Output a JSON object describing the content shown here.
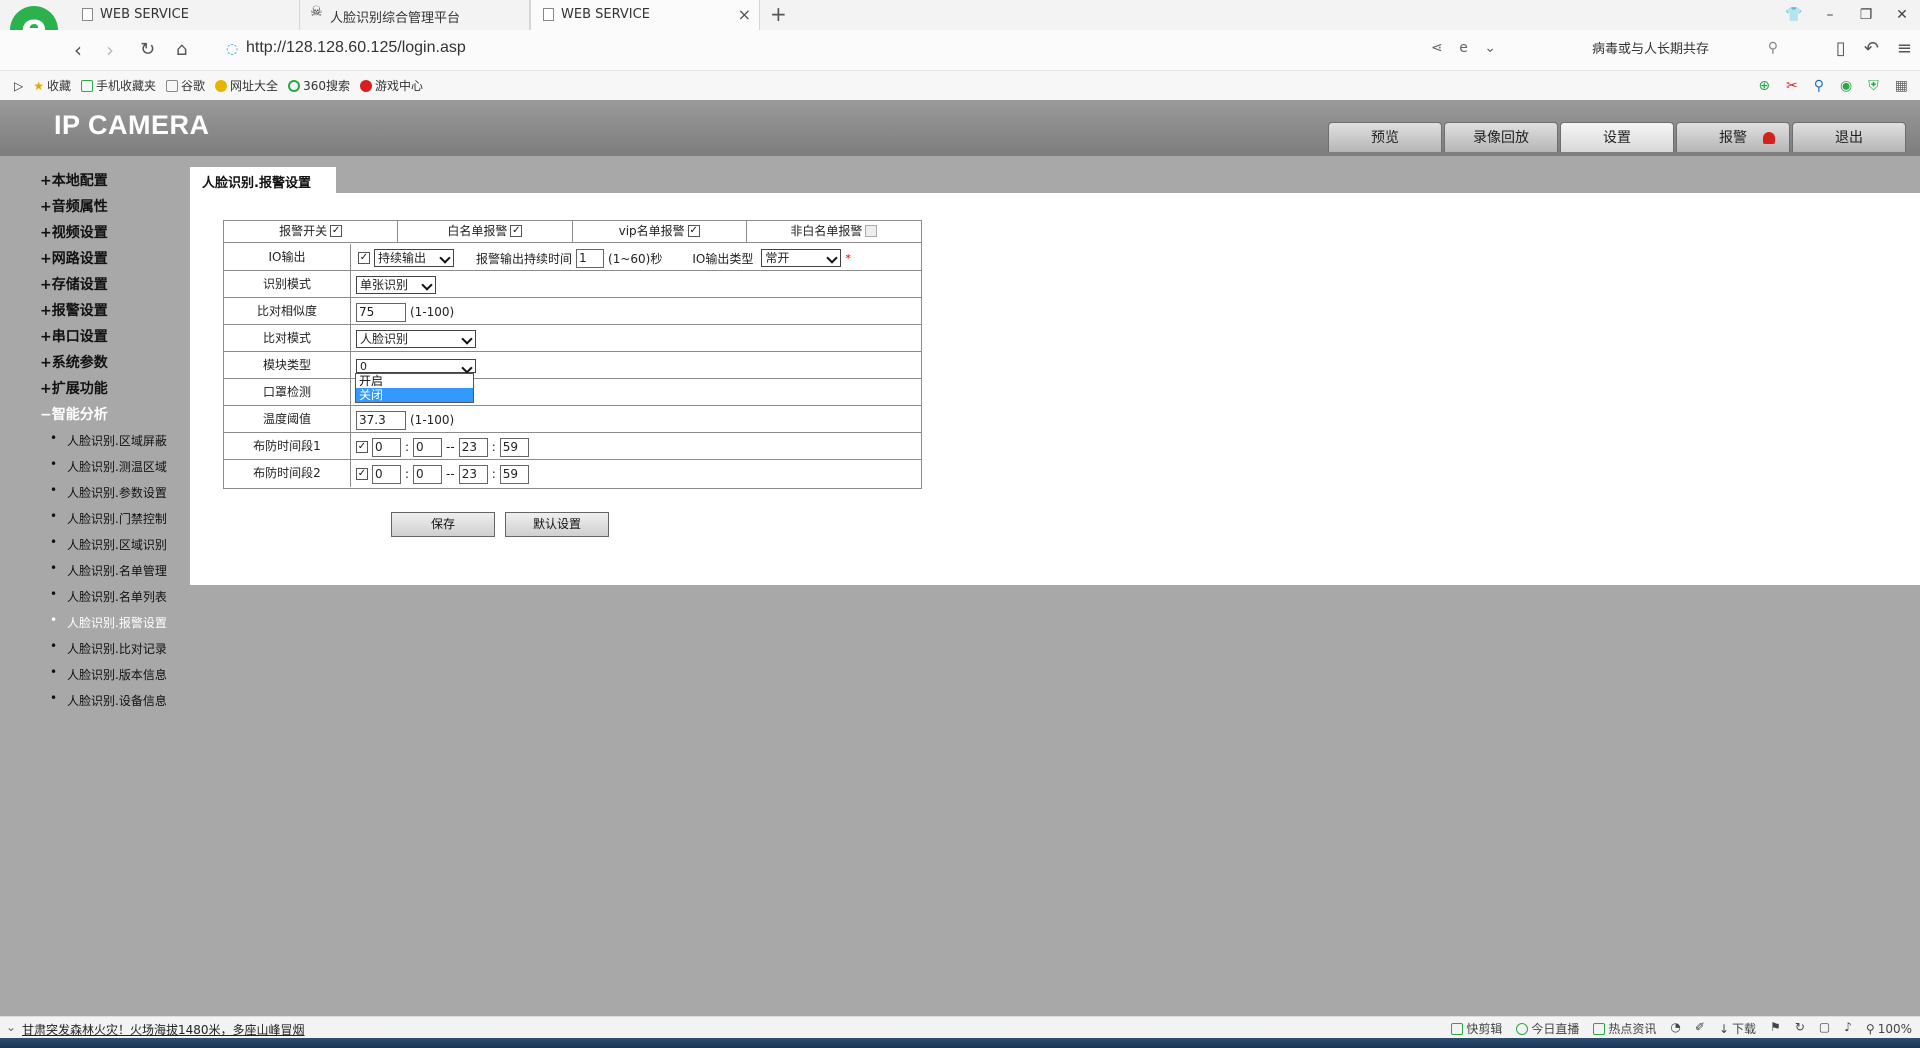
{
  "browser": {
    "tabs": [
      {
        "title": "WEB SERVICE",
        "icon": "page-icon"
      },
      {
        "title": "人脸识别综合管理平台",
        "icon": "skull-icon"
      },
      {
        "title": "WEB SERVICE",
        "icon": "page-icon",
        "active": true
      }
    ],
    "close_glyph": "×",
    "new_tab_glyph": "+",
    "url": "http://128.128.60.125/login.asp",
    "search_text": "病毒或与人长期共存",
    "bookmarks": [
      "收藏",
      "手机收藏夹",
      "谷歌",
      "网址大全",
      "360搜索",
      "游戏中心"
    ]
  },
  "camera": {
    "brand": "IP CAMERA",
    "nav": [
      "预览",
      "录像回放",
      "设置",
      "报警",
      "退出"
    ],
    "active_nav": "设置",
    "sidebar_menu": [
      "+本地配置",
      "+音频属性",
      "+视频设置",
      "+网路设置",
      "+存储设置",
      "+报警设置",
      "+串口设置",
      "+系统参数",
      "+扩展功能",
      "−智能分析"
    ],
    "sidebar_sub": [
      "人脸识别.区域屏蔽",
      "人脸识别.测温区域",
      "人脸识别.参数设置",
      "人脸识别.门禁控制",
      "人脸识别.区域识别",
      "人脸识别.名单管理",
      "人脸识别.名单列表",
      "人脸识别.报警设置",
      "人脸识别.比对记录",
      "人脸识别.版本信息",
      "人脸识别.设备信息"
    ],
    "current_sub": "人脸识别.报警设置",
    "panel_title": "人脸识别.报警设置",
    "header_row": [
      {
        "label": "报警开关",
        "checked": true
      },
      {
        "label": "白名单报警",
        "checked": true
      },
      {
        "label": "vip名单报警",
        "checked": true
      },
      {
        "label": "非白名单报警",
        "checked": false
      }
    ],
    "io_output": {
      "label": "IO输出",
      "mode": "持续输出",
      "duration_label": "报警输出持续时间",
      "duration_value": "1",
      "duration_range": "(1~60)秒",
      "type_label": "IO输出类型",
      "type_value": "常开",
      "required_mark": "*"
    },
    "recog_mode": {
      "label": "识别模式",
      "value": "单张识别"
    },
    "similarity": {
      "label": "比对相似度",
      "value": "75",
      "range": "(1-100)"
    },
    "compare_mode": {
      "label": "比对模式",
      "value": "人脸识别"
    },
    "module_type": {
      "label": "模块类型",
      "value": "0"
    },
    "mask_detect": {
      "label": "口罩检测"
    },
    "dropdown_options": [
      "开启",
      "关闭"
    ],
    "dropdown_selected": "关闭",
    "temp_threshold": {
      "label": "温度阈值",
      "value": "37.3",
      "range": "(1-100)"
    },
    "schedule1": {
      "label": "布防时间段1",
      "checked": true,
      "start_h": "0",
      "start_m": "0",
      "end_h": "23",
      "end_m": "59"
    },
    "schedule2": {
      "label": "布防时间段2",
      "checked": true,
      "start_h": "0",
      "start_m": "0",
      "end_h": "23",
      "end_m": "59"
    },
    "time_colon": ":",
    "time_dash": "--",
    "save_button": "保存",
    "default_button": "默认设置"
  },
  "status": {
    "news": "甘肃突发森林火灾！火场海拔1480米，多座山峰冒烟",
    "tools": [
      "快剪辑",
      "今日直播",
      "热点资讯",
      "下载",
      "100%"
    ]
  },
  "colors": {
    "page_bg": "#a8a8a8",
    "header_gradient_top": "#9a9a9a",
    "selected_option": "#3399ff",
    "alarm_red": "#d62020"
  }
}
